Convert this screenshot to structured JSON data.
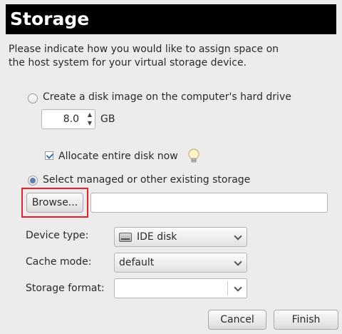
{
  "header": {
    "title": "Storage"
  },
  "description": "Please indicate how you would like to assign space on the host system for your virtual storage device.",
  "options": {
    "create_disk_label": "Create a disk image on the computer's hard drive",
    "size_value": "8.0",
    "size_unit": "GB",
    "allocate_label": "Allocate entire disk now",
    "allocate_checked": true,
    "managed_label": "Select managed or other existing storage",
    "selected_option": "managed"
  },
  "browse": {
    "label": "Browse...",
    "path_value": ""
  },
  "device_type": {
    "label": "Device type:",
    "value": "IDE disk",
    "icon": "harddisk-icon"
  },
  "cache_mode": {
    "label": "Cache mode:",
    "value": "default"
  },
  "storage_format": {
    "label": "Storage format:",
    "value": ""
  },
  "buttons": {
    "cancel": "Cancel",
    "finish": "Finish"
  },
  "colors": {
    "header_bg": "#000000",
    "highlight": "#e8202a",
    "window_bg": "#ececec"
  }
}
